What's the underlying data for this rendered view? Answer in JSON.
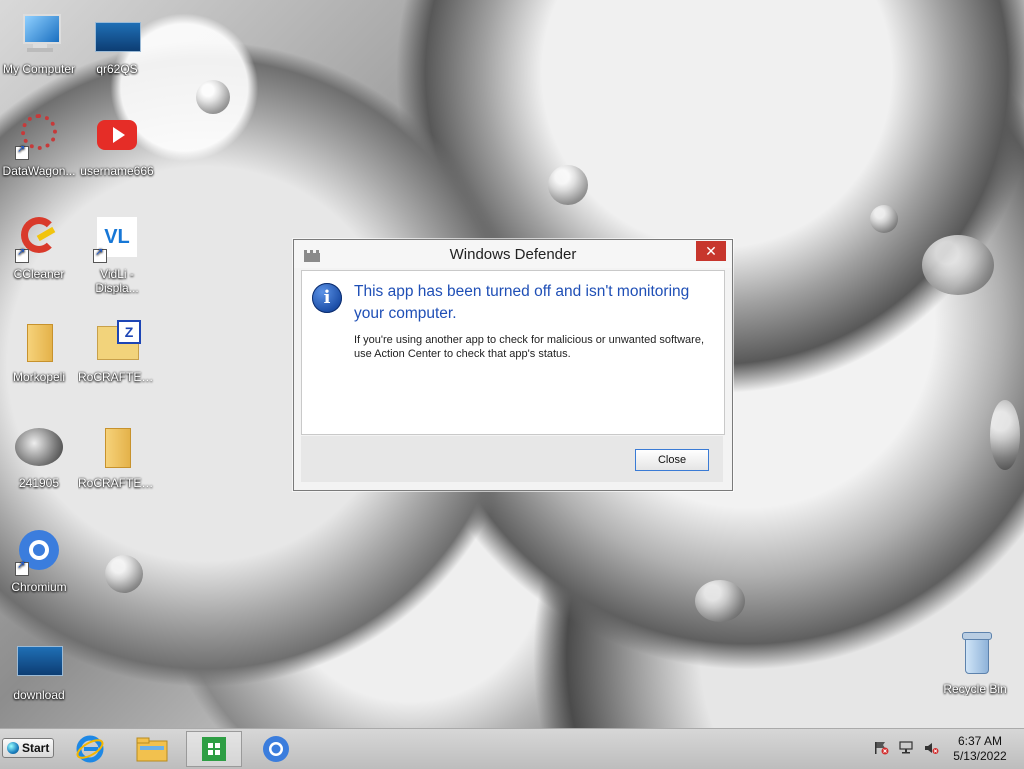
{
  "desktop": {
    "icons": [
      {
        "label": "My Computer",
        "icon": "computer-icon"
      },
      {
        "label": "qr62QS",
        "icon": "picture-icon"
      },
      {
        "label": "DataWagon...",
        "icon": "datawagon-icon"
      },
      {
        "label": "username666",
        "icon": "youtube-icon"
      },
      {
        "label": "CCleaner",
        "icon": "ccleaner-icon"
      },
      {
        "label": "VidLi - Displa...",
        "icon": "vidli-icon"
      },
      {
        "label": "Morkopeli",
        "icon": "folder-icon"
      },
      {
        "label": "RoCRAFTER...",
        "icon": "zip-folder-icon"
      },
      {
        "label": "241905",
        "icon": "image-thumb-icon"
      },
      {
        "label": "RoCRAFTER...",
        "icon": "folder-icon"
      },
      {
        "label": "Chromium",
        "icon": "chromium-icon"
      },
      {
        "label": "download",
        "icon": "picture-icon"
      },
      {
        "label": "Recycle Bin",
        "icon": "recycle-bin-icon"
      }
    ]
  },
  "dialog": {
    "title": "Windows Defender",
    "close_glyph": "✕",
    "headline": "This app has been turned off and isn't monitoring your computer.",
    "body": "If you're using another app to check for malicious or unwanted software, use Action Center to check that app's status.",
    "button_label": "Close",
    "info_glyph": "i"
  },
  "taskbar": {
    "start_label": "Start",
    "pinned": [
      "internet-explorer-icon",
      "file-explorer-icon",
      "store-icon",
      "chromium-icon"
    ],
    "tray": [
      "action-center-flag-icon",
      "network-icon",
      "volume-muted-icon"
    ],
    "time": "6:37 AM",
    "date": "5/13/2022"
  }
}
